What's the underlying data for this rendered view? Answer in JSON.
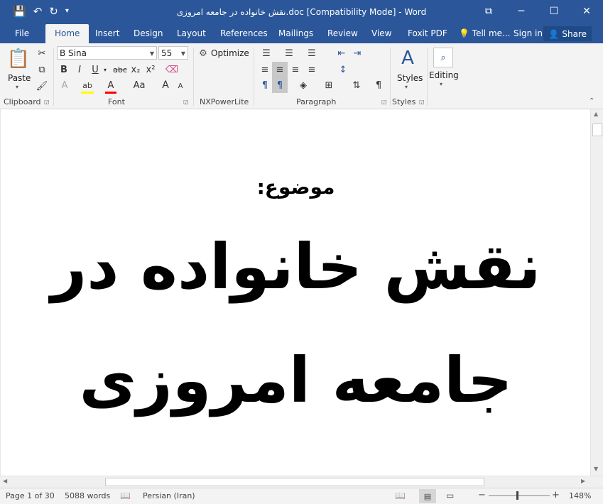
{
  "window": {
    "title": "نقش خانواده در جامعه امروزی.doc [Compatibility Mode] - Word",
    "controls": {
      "ribbon_options": "⧉",
      "minimize": "─",
      "maximize": "☐",
      "close": "✕"
    }
  },
  "qat": {
    "save_icon": "💾",
    "undo_icon": "↶",
    "redo_icon": "↻",
    "customize_icon": "▾"
  },
  "tabs": [
    "File",
    "Home",
    "Insert",
    "Design",
    "Layout",
    "References",
    "Mailings",
    "Review",
    "View",
    "Foxit PDF"
  ],
  "tell_me": "Tell me...",
  "sign_in": "Sign in",
  "share": "Share",
  "ribbon": {
    "clipboard": {
      "paste": "Paste",
      "label": "Clipboard"
    },
    "font": {
      "name": "B Sina",
      "size": "55",
      "label": "Font",
      "bold": "B",
      "italic": "I",
      "underline": "U",
      "strike": "abc",
      "subscript": "x₂",
      "superscript": "x²",
      "text_effects": "A",
      "highlight": "ab",
      "font_color": "A",
      "change_case": "Aa",
      "grow": "A",
      "shrink": "A"
    },
    "nxpowerlite": {
      "optimize": "Optimize",
      "label": "NXPowerLite"
    },
    "paragraph": {
      "label": "Paragraph",
      "pilcrow": "¶"
    },
    "styles": {
      "styles": "Styles",
      "label": "Styles"
    },
    "editing": {
      "editing": "Editing"
    }
  },
  "document": {
    "lines": [
      "موضوع:",
      "نقش خانواده در",
      "جامعه امروزی"
    ]
  },
  "status": {
    "page": "Page 1 of 30",
    "words": "5088 words",
    "language": "Persian (Iran)",
    "zoom": "148%",
    "zoom_minus": "−",
    "zoom_plus": "+"
  },
  "colors": {
    "brand": "#2b579a",
    "highlight": "#ffff00",
    "font_color": "#ff0000"
  }
}
